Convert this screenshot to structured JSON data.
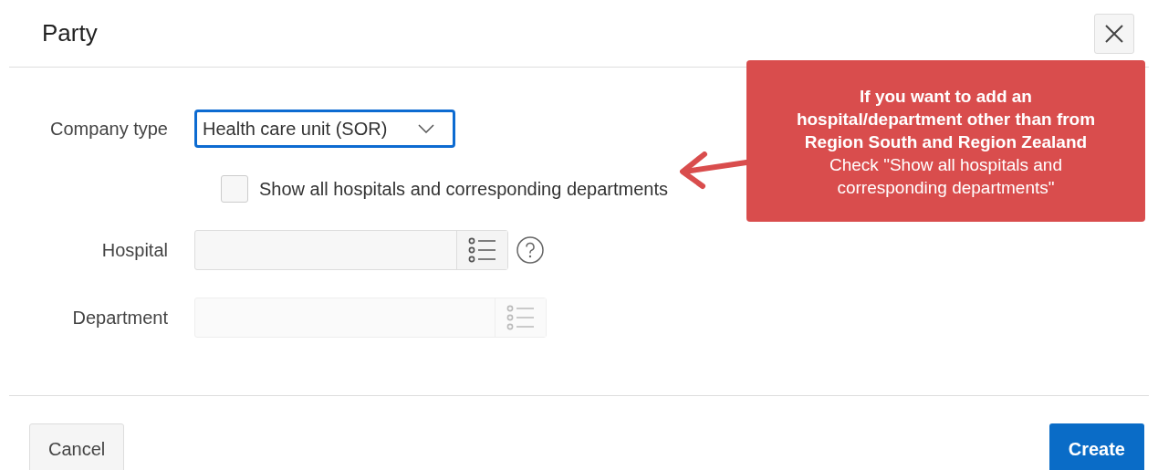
{
  "dialog": {
    "title": "Party"
  },
  "fields": [
    {
      "kind": "select",
      "label": "Company type",
      "value": "Health care unit (SOR)",
      "focused": true
    },
    {
      "kind": "checkbox",
      "label": "Show all hospitals and corresponding departments",
      "checked": false
    },
    {
      "kind": "lov",
      "label": "Hospital",
      "disabled": false,
      "help": true
    },
    {
      "kind": "lov",
      "label": "Department",
      "disabled": true,
      "help": false
    }
  ],
  "callout": {
    "heading": "If you want to add an hospital/department other than from Region South and Region Zealand",
    "body": "Check \"Show all hospitals and corresponding departments\""
  },
  "buttons": [
    {
      "label": "Cancel",
      "kind": "secondary"
    },
    {
      "label": "Create",
      "kind": "primary"
    }
  ]
}
